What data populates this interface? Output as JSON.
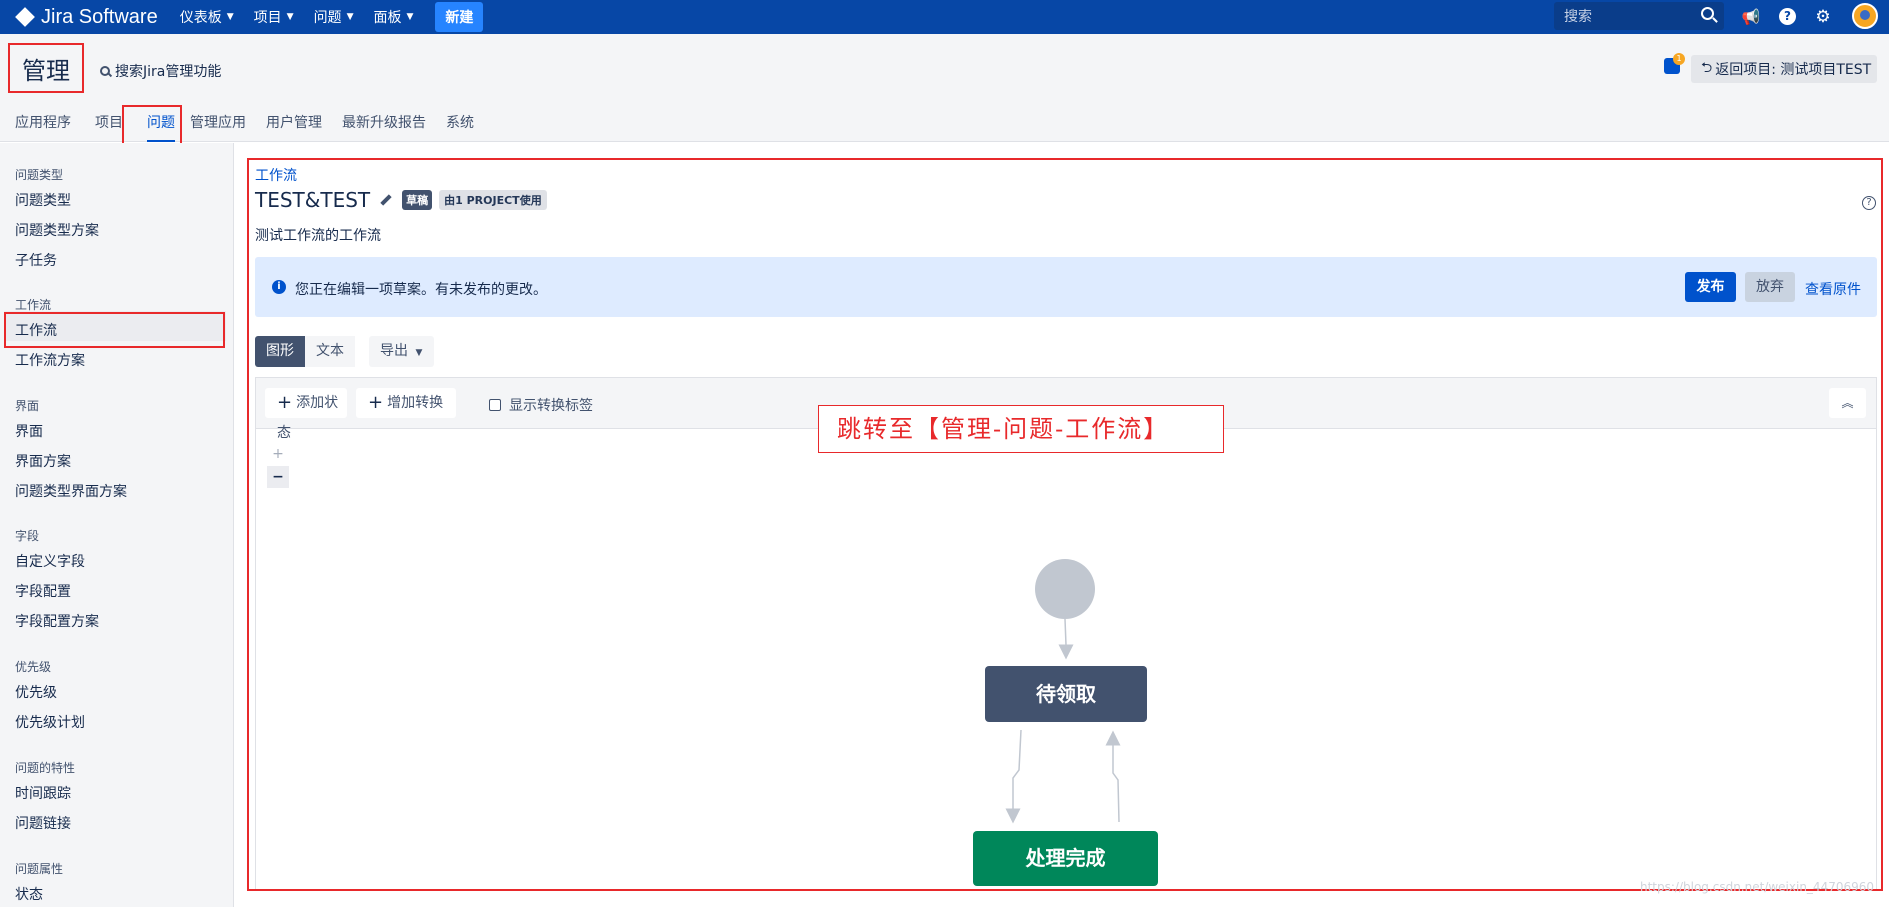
{
  "topbar": {
    "logo_text": "Jira Software",
    "nav": [
      "仪表板",
      "项目",
      "问题",
      "面板"
    ],
    "create_label": "新建",
    "search_placeholder": "搜索",
    "brand_color": "#0747a6"
  },
  "admin": {
    "title": "管理",
    "search_label": "搜索Jira管理功能",
    "notification_count": "1",
    "back_label": "返回项目: 测试项目TEST",
    "tabs": [
      "应用程序",
      "项目",
      "问题",
      "管理应用",
      "用户管理",
      "最新升级报告",
      "系统"
    ],
    "active_tab": "问题"
  },
  "sidebar": {
    "groups": [
      {
        "heading": "问题类型",
        "items": [
          "问题类型",
          "问题类型方案",
          "子任务"
        ]
      },
      {
        "heading": "工作流",
        "items": [
          "工作流",
          "工作流方案"
        ]
      },
      {
        "heading": "界面",
        "items": [
          "界面",
          "界面方案",
          "问题类型界面方案"
        ]
      },
      {
        "heading": "字段",
        "items": [
          "自定义字段",
          "字段配置",
          "字段配置方案"
        ]
      },
      {
        "heading": "优先级",
        "items": [
          "优先级",
          "优先级计划"
        ]
      },
      {
        "heading": "问题的特性",
        "items": [
          "时间跟踪",
          "问题链接"
        ]
      },
      {
        "heading": "问题属性",
        "items": [
          "状态"
        ]
      }
    ],
    "active_item": "工作流"
  },
  "workflow": {
    "breadcrumb": "工作流",
    "name": "TEST&TEST",
    "draft_badge": "草稿",
    "usage_badge": "由1 PROJECT使用",
    "description": "测试工作流的工作流",
    "help_icon": "question-icon",
    "info_message": "您正在编辑一项草案。有未发布的更改。",
    "publish_label": "发布",
    "discard_label": "放弃",
    "view_original_label": "查看原件",
    "view_tabs": [
      "图形",
      "文本"
    ],
    "export_label": "导出",
    "add_status_label": "添加状态",
    "add_transition_label": "增加转换",
    "show_labels_label": "显示转换标签",
    "show_labels_checked": false,
    "zoom_in": "+",
    "zoom_out": "−",
    "statuses": [
      {
        "name": "待领取",
        "color": "#42526e"
      },
      {
        "name": "处理完成",
        "color": "#00875a"
      }
    ]
  },
  "annotation_text": "跳转至【管理-问题-工作流】",
  "highlight_color": "#e8292b",
  "watermark": "https://blog.csdn.net/weixin_44706960"
}
